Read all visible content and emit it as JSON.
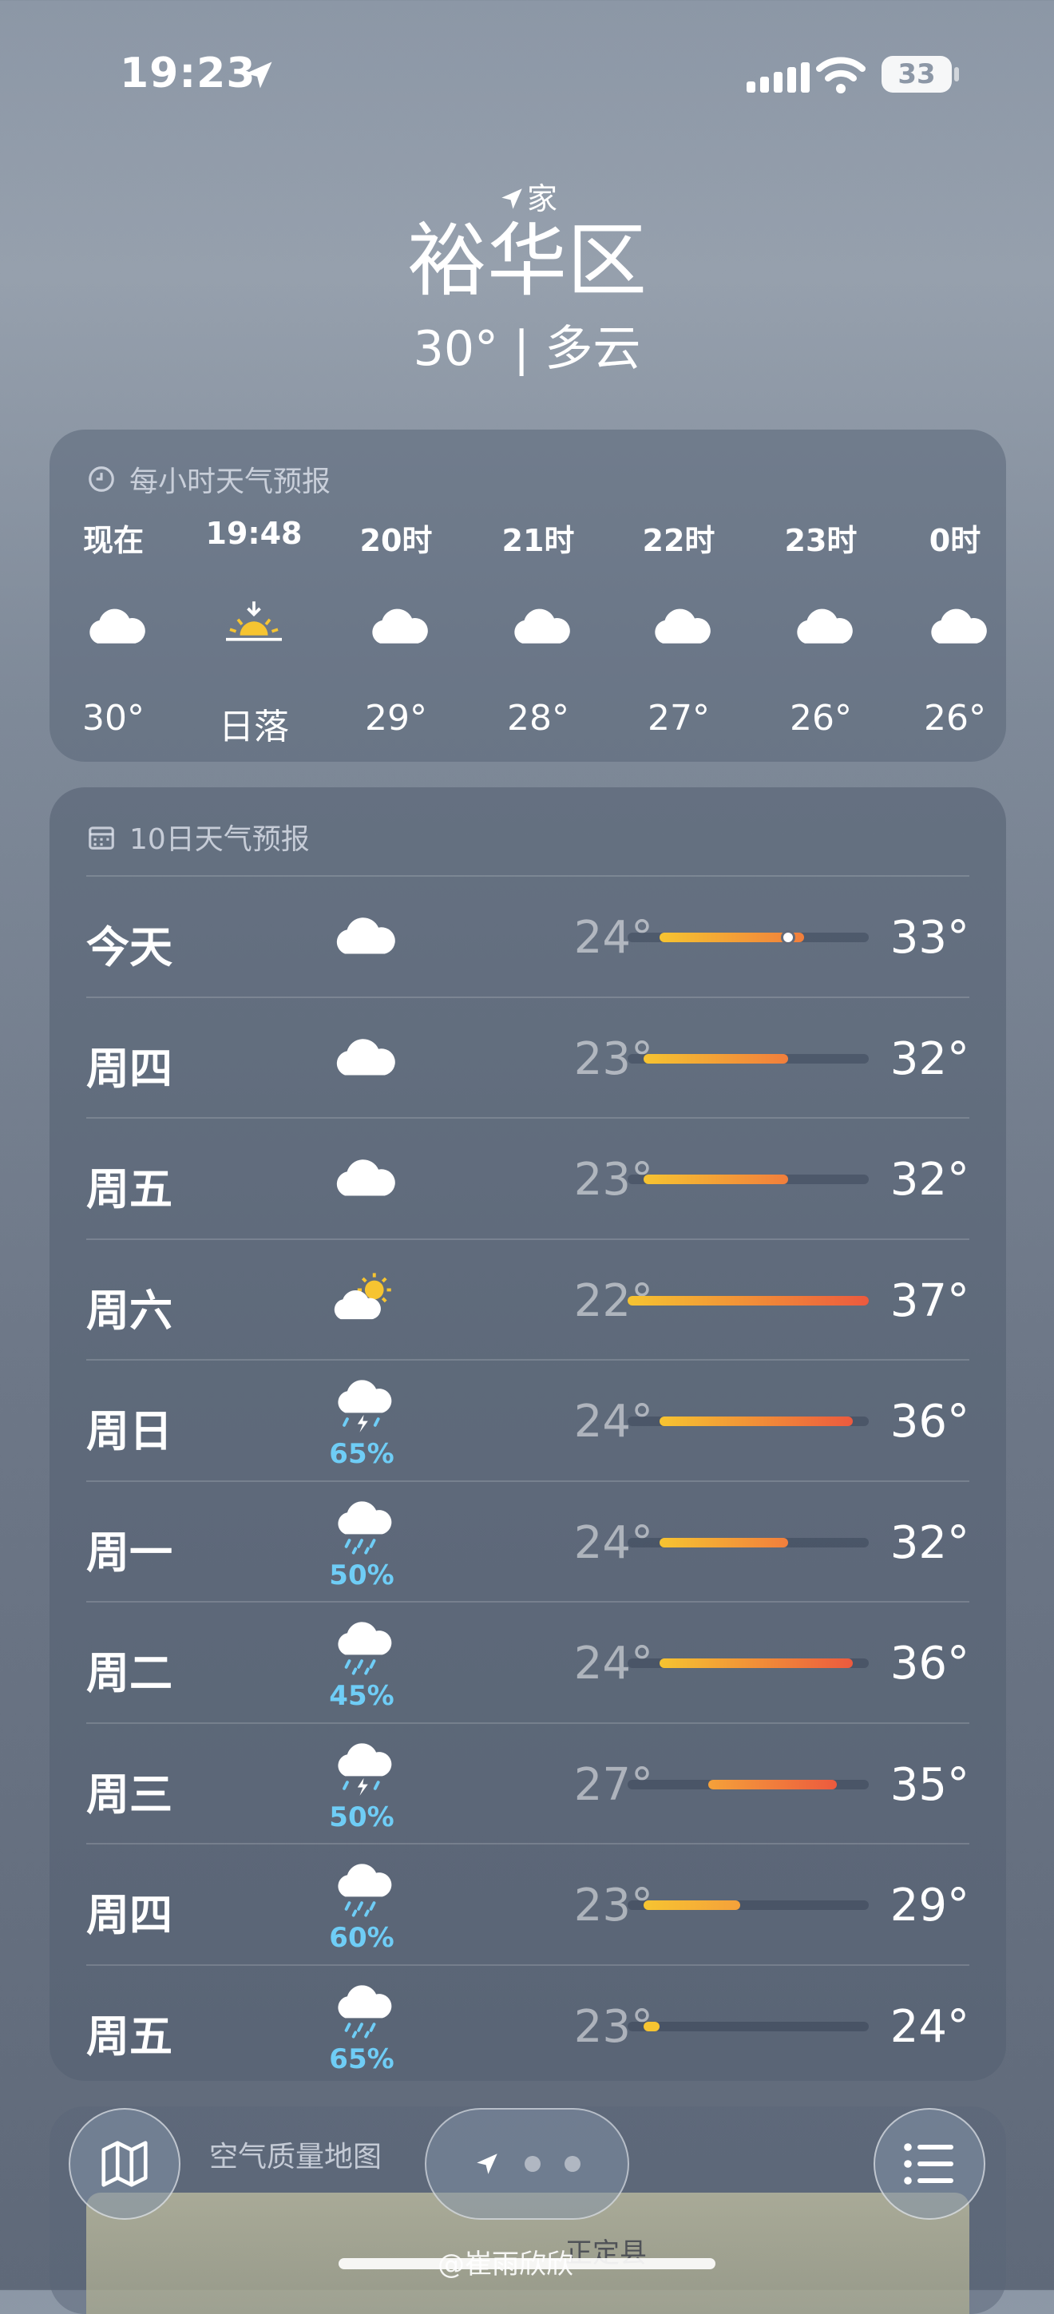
{
  "status_bar": {
    "time": "19:23",
    "battery": "33"
  },
  "header": {
    "location_label": "家",
    "city": "裕华区",
    "current": "30° | 多云"
  },
  "hourly": {
    "title": "每小时天气预报",
    "items": [
      {
        "label": "现在",
        "icon": "cloud-icon",
        "temp": "30°"
      },
      {
        "label": "19:48",
        "icon": "sunset-icon",
        "temp": "日落"
      },
      {
        "label": "20时",
        "icon": "cloud-icon",
        "temp": "29°"
      },
      {
        "label": "21时",
        "icon": "cloud-icon",
        "temp": "28°"
      },
      {
        "label": "22时",
        "icon": "cloud-icon",
        "temp": "27°"
      },
      {
        "label": "23时",
        "icon": "cloud-icon",
        "temp": "26°"
      },
      {
        "label": "0时",
        "icon": "cloud-icon",
        "temp": "26°"
      }
    ]
  },
  "daily": {
    "title": "10日天气预报",
    "range_min": 22,
    "range_max": 37,
    "current_temp": 30,
    "items": [
      {
        "day": "今天",
        "icon": "cloud-icon",
        "precip": "",
        "low": "24°",
        "high": "33°",
        "low_v": 24,
        "high_v": 33
      },
      {
        "day": "周四",
        "icon": "cloud-icon",
        "precip": "",
        "low": "23°",
        "high": "32°",
        "low_v": 23,
        "high_v": 32
      },
      {
        "day": "周五",
        "icon": "cloud-icon",
        "precip": "",
        "low": "23°",
        "high": "32°",
        "low_v": 23,
        "high_v": 32
      },
      {
        "day": "周六",
        "icon": "partly-sunny-icon",
        "precip": "",
        "low": "22°",
        "high": "37°",
        "low_v": 22,
        "high_v": 37
      },
      {
        "day": "周日",
        "icon": "thunderstorm-icon",
        "precip": "65%",
        "low": "24°",
        "high": "36°",
        "low_v": 24,
        "high_v": 36
      },
      {
        "day": "周一",
        "icon": "rain-icon",
        "precip": "50%",
        "low": "24°",
        "high": "32°",
        "low_v": 24,
        "high_v": 32
      },
      {
        "day": "周二",
        "icon": "rain-icon",
        "precip": "45%",
        "low": "24°",
        "high": "36°",
        "low_v": 24,
        "high_v": 36
      },
      {
        "day": "周三",
        "icon": "thunderstorm-icon",
        "precip": "50%",
        "low": "27°",
        "high": "35°",
        "low_v": 27,
        "high_v": 35
      },
      {
        "day": "周四",
        "icon": "rain-icon",
        "precip": "60%",
        "low": "23°",
        "high": "29°",
        "low_v": 23,
        "high_v": 29
      },
      {
        "day": "周五",
        "icon": "rain-icon",
        "precip": "65%",
        "low": "23°",
        "high": "24°",
        "low_v": 23,
        "high_v": 24
      }
    ]
  },
  "air_quality": {
    "title": "空气质量地图",
    "map_label": "正定县"
  },
  "watermark": "@崔雨欣欣"
}
